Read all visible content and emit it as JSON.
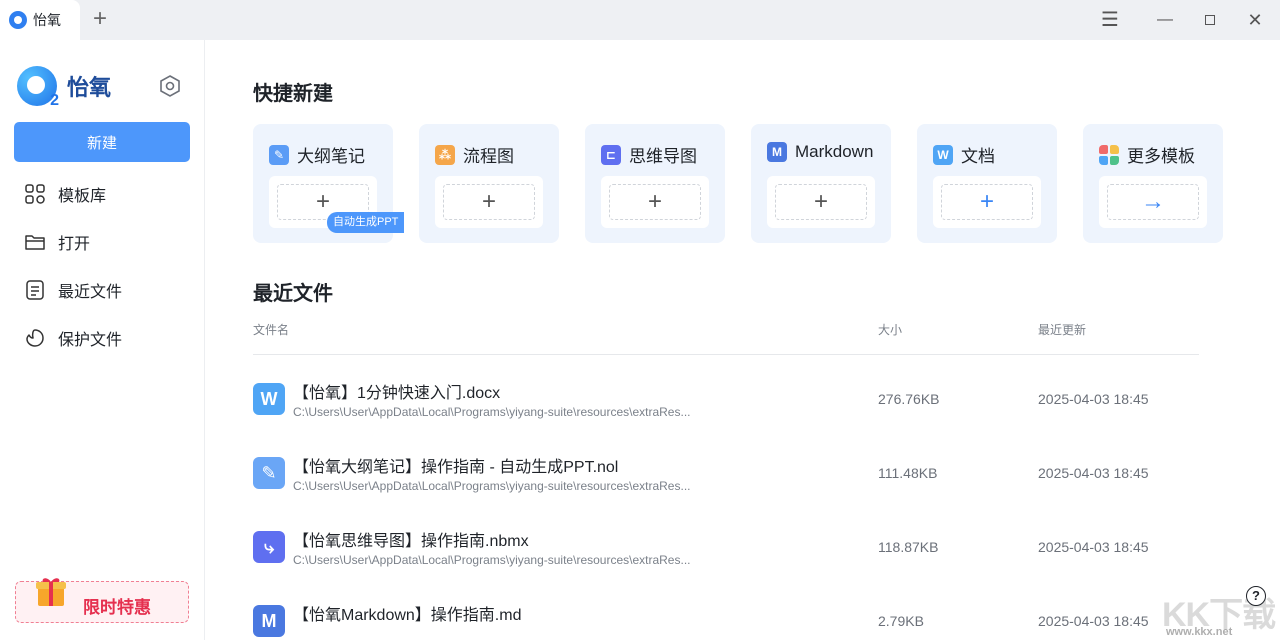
{
  "titlebar": {
    "tab_label": "怡氧",
    "new_tab_symbol": "+",
    "menu_symbol": "☰",
    "minimize_symbol": "—",
    "close_symbol": "✕"
  },
  "sidebar": {
    "brand_name": "怡氧",
    "brand_logo_text": "2",
    "new_button": "新建",
    "items": [
      {
        "label": "模板库",
        "icon": "grid-icon"
      },
      {
        "label": "打开",
        "icon": "folder-icon"
      },
      {
        "label": "最近文件",
        "icon": "document-icon"
      },
      {
        "label": "保护文件",
        "icon": "shield-icon"
      }
    ],
    "promo_label": "限时特惠"
  },
  "quick_create": {
    "title": "快捷新建",
    "badge": "自动生成PPT",
    "cards": [
      {
        "label": "大纲笔记",
        "icon": "pen-icon",
        "color": "#5b9cf6",
        "action": "+"
      },
      {
        "label": "流程图",
        "icon": "flowchart-icon",
        "color": "#f5a64a",
        "action": "+"
      },
      {
        "label": "思维导图",
        "icon": "mindmap-icon",
        "color": "#5f6ff0",
        "action": "+"
      },
      {
        "label": "Markdown",
        "icon": "markdown-icon",
        "color": "#4a78e0",
        "action": "+"
      },
      {
        "label": "文档",
        "icon": "word-icon",
        "color": "#4fa5f5",
        "action": "+"
      },
      {
        "label": "更多模板",
        "icon": "templates-icon",
        "color": "#f06a6a",
        "action": "→"
      }
    ]
  },
  "recent": {
    "title": "最近文件",
    "columns": {
      "name": "文件名",
      "size": "大小",
      "updated": "最近更新"
    },
    "files": [
      {
        "name": "【怡氧】1分钟快速入门.docx",
        "path": "C:\\Users\\User\\AppData\\Local\\Programs\\yiyang-suite\\resources\\extraRes...",
        "size": "276.76KB",
        "updated": "2025-04-03 18:45",
        "icon": "word-file-icon",
        "icon_text": "W",
        "color": "#4fa5f5"
      },
      {
        "name": "【怡氧大纲笔记】操作指南 - 自动生成PPT.nol",
        "path": "C:\\Users\\User\\AppData\\Local\\Programs\\yiyang-suite\\resources\\extraRes...",
        "size": "111.48KB",
        "updated": "2025-04-03 18:45",
        "icon": "outline-file-icon",
        "icon_text": "✎",
        "color": "#6aa6f6"
      },
      {
        "name": "【怡氧思维导图】操作指南.nbmx",
        "path": "C:\\Users\\User\\AppData\\Local\\Programs\\yiyang-suite\\resources\\extraRes...",
        "size": "118.87KB",
        "updated": "2025-04-03 18:45",
        "icon": "mindmap-file-icon",
        "icon_text": "⤷",
        "color": "#5f6ff0"
      },
      {
        "name": "【怡氧Markdown】操作指南.md",
        "path": "",
        "size": "2.79KB",
        "updated": "2025-04-03 18:45",
        "icon": "markdown-file-icon",
        "icon_text": "M",
        "color": "#4a78e0"
      }
    ]
  },
  "help_symbol": "?",
  "watermark": {
    "text": "KK下载",
    "sub": "www.kkx.net"
  }
}
